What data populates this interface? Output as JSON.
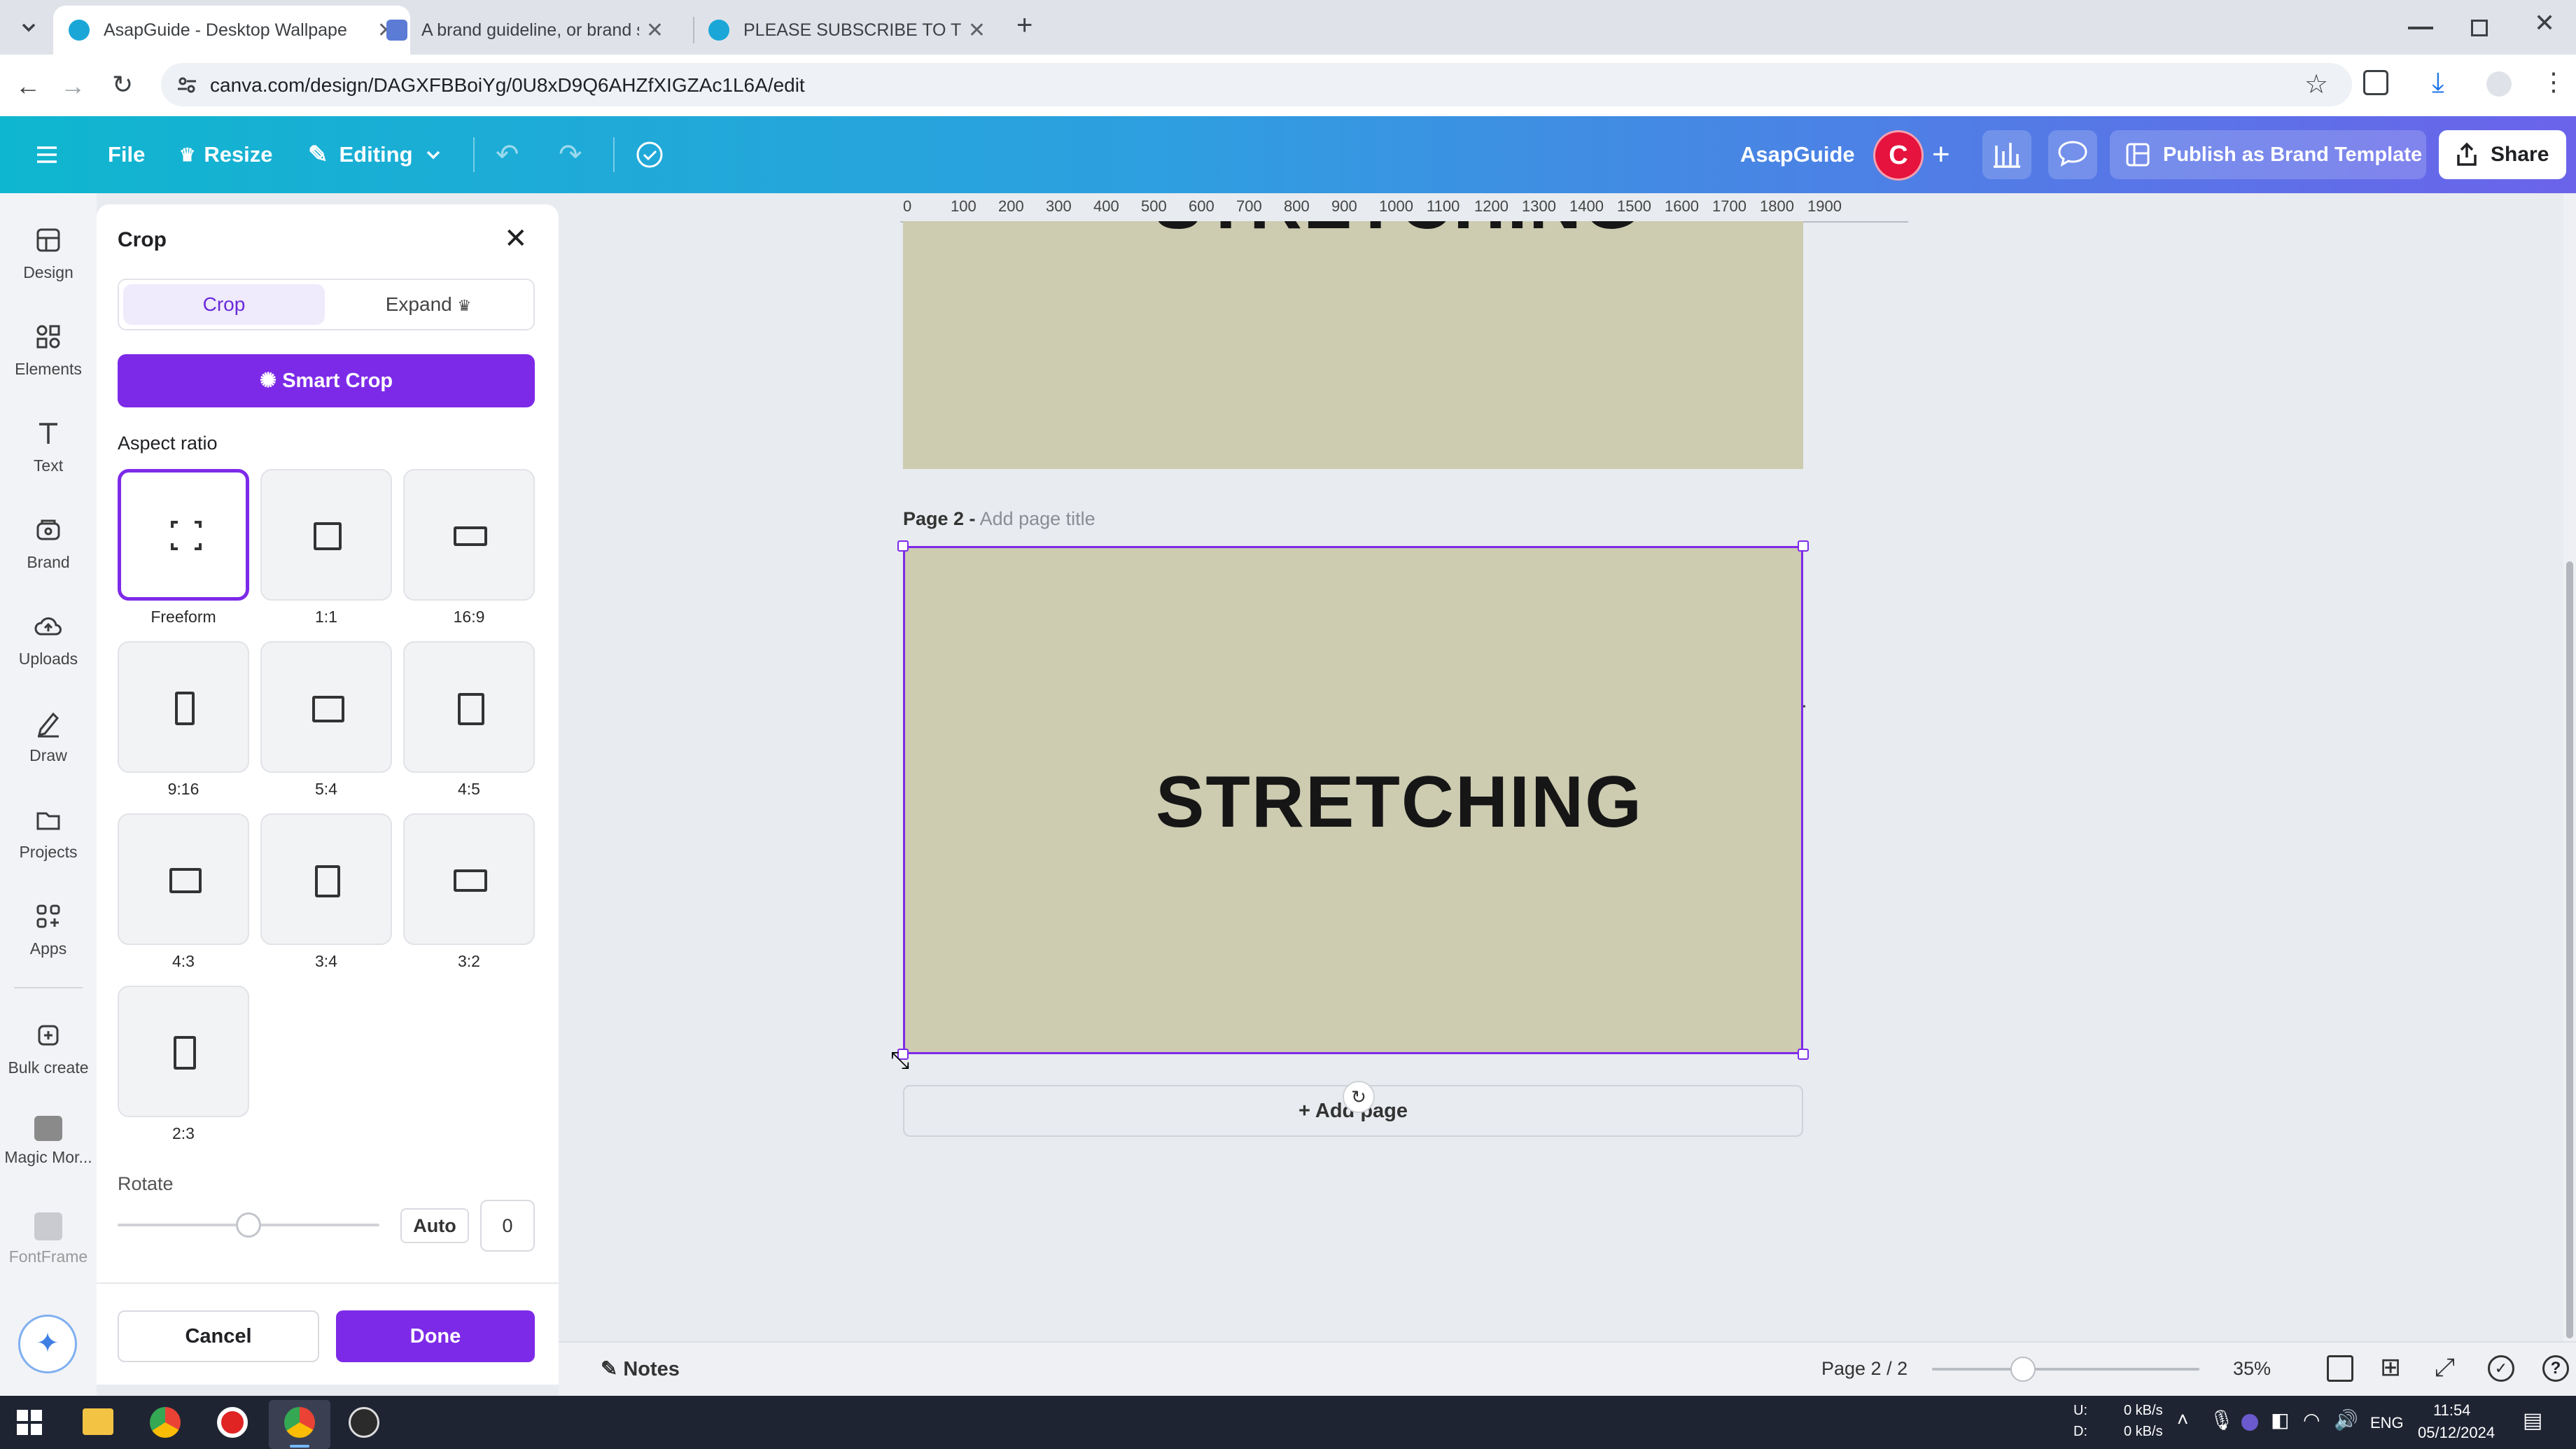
{
  "browser": {
    "tabs": [
      {
        "title": "AsapGuide - Desktop Wallpape",
        "active": true
      },
      {
        "title": "A brand guideline, or brand sty",
        "active": false
      },
      {
        "title": "PLEASE SUBSCRIBE TO THIS CH",
        "active": false
      }
    ],
    "url": "canva.com/design/DAGXFBBoiYg/0U8xD9Q6AHZfXIGZAc1L6A/edit"
  },
  "header": {
    "file_label": "File",
    "resize_label": "Resize",
    "editing_label": "Editing",
    "brand_name": "AsapGuide",
    "avatar_letter": "C",
    "publish_label": "Publish as Brand Template",
    "share_label": "Share"
  },
  "rail": {
    "items": [
      {
        "label": "Design",
        "icon": "layout-icon"
      },
      {
        "label": "Elements",
        "icon": "shapes-icon"
      },
      {
        "label": "Text",
        "icon": "text-icon"
      },
      {
        "label": "Brand",
        "icon": "brand-icon"
      },
      {
        "label": "Uploads",
        "icon": "cloud-upload-icon"
      },
      {
        "label": "Draw",
        "icon": "pen-icon"
      },
      {
        "label": "Projects",
        "icon": "folder-icon"
      },
      {
        "label": "Apps",
        "icon": "apps-icon"
      },
      {
        "label": "Bulk create",
        "icon": "bulk-create-icon"
      },
      {
        "label": "Magic Mor...",
        "icon": "magic-morph-icon"
      },
      {
        "label": "FontFrame",
        "icon": "fontframe-icon"
      }
    ]
  },
  "panel": {
    "title": "Crop",
    "tab_crop": "Crop",
    "tab_expand": "Expand",
    "smart_crop_label": "Smart Crop",
    "aspect_ratio_heading": "Aspect ratio",
    "ratios": [
      {
        "label": "Freeform",
        "selected": true
      },
      {
        "label": "1:1",
        "selected": false
      },
      {
        "label": "16:9",
        "selected": false
      },
      {
        "label": "9:16",
        "selected": false
      },
      {
        "label": "5:4",
        "selected": false
      },
      {
        "label": "4:5",
        "selected": false
      },
      {
        "label": "4:3",
        "selected": false
      },
      {
        "label": "3:4",
        "selected": false
      },
      {
        "label": "3:2",
        "selected": false
      },
      {
        "label": "2:3",
        "selected": false
      }
    ],
    "rotate_heading": "Rotate",
    "rotate_auto": "Auto",
    "rotate_value": "0",
    "rotate_slider_fraction": 0.5,
    "cancel_label": "Cancel",
    "done_label": "Done"
  },
  "canvas": {
    "ruler_ticks": [
      "0",
      "100",
      "200",
      "300",
      "400",
      "500",
      "600",
      "700",
      "800",
      "900",
      "1000",
      "1100",
      "1200",
      "1300",
      "1400",
      "1500",
      "1600",
      "1700",
      "1800",
      "1900"
    ],
    "page1_text": "STRETCHING",
    "page2_label": "Page 2 -",
    "page2_title_placeholder": "Add page title",
    "page2_text": "STRETCHING",
    "add_page_label": "+ Add page",
    "page_color": "#cdcbb0"
  },
  "footer": {
    "notes_label": "Notes",
    "page_indicator": "Page 2 / 2",
    "zoom_label": "35%",
    "zoom_fraction": 0.34
  },
  "taskbar": {
    "net_up_label": "U:",
    "net_down_label": "D:",
    "net_up": "0 kB/s",
    "net_down": "0 kB/s",
    "lang": "ENG",
    "time": "11:54",
    "date": "05/12/2024"
  },
  "colors": {
    "accent": "#7d2ae8",
    "header_gradient_start": "#0fb6cf",
    "header_gradient_end": "#6b63ea",
    "avatar": "#e5133d"
  }
}
